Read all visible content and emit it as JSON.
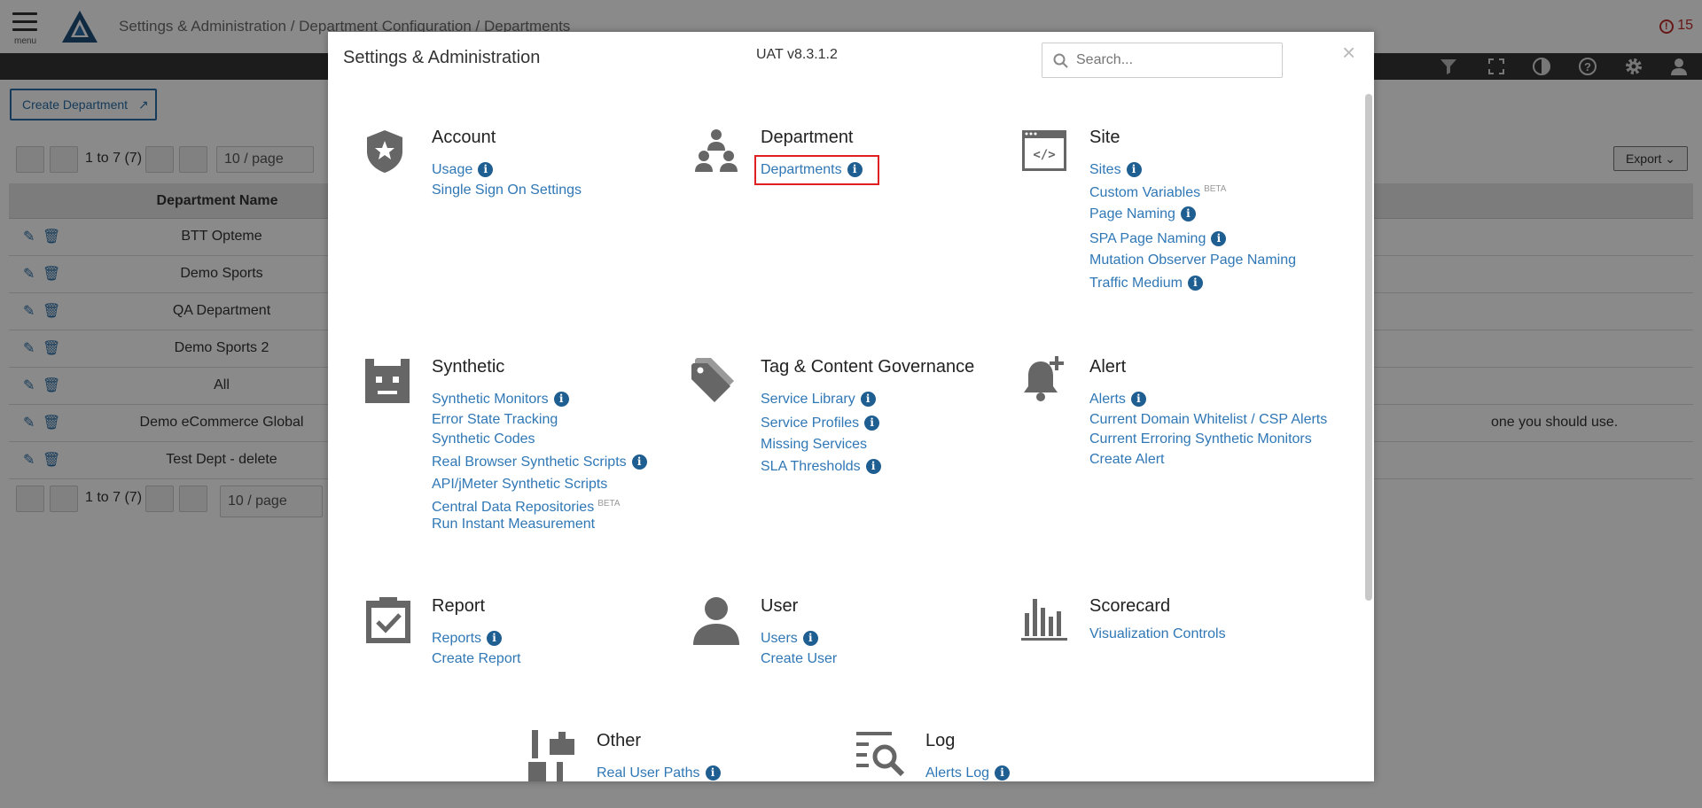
{
  "topbar": {
    "menu_label": "menu",
    "breadcrumb": "Settings & Administration / Department Configuration / Departments",
    "alert_count": "15"
  },
  "toolbar": {
    "create_department": "Create Department",
    "export": "Export"
  },
  "pager_top": {
    "range": "1 to 7 (7)",
    "page_size": "10 / page"
  },
  "pager_bottom": {
    "range": "1 to 7 (7)",
    "page_size": "10 / page"
  },
  "table": {
    "header": "Department Name",
    "rows": [
      "BTT Opteme",
      "Demo Sports",
      "QA Department",
      "Demo Sports 2",
      "All",
      "Demo eCommerce Global",
      "Test Dept - delete"
    ],
    "partial_text": "one you should use."
  },
  "modal": {
    "title": "Settings & Administration",
    "version": "UAT v8.3.1.2",
    "search_placeholder": "Search...",
    "close": "×",
    "sections": {
      "account": {
        "title": "Account",
        "links": [
          "Usage",
          "Single Sign On Settings"
        ]
      },
      "department": {
        "title": "Department",
        "links": [
          "Departments"
        ]
      },
      "site": {
        "title": "Site",
        "links": [
          "Sites",
          "Custom Variables",
          "Page Naming",
          "SPA Page Naming",
          "Mutation Observer Page Naming",
          "Traffic Medium"
        ],
        "beta": "BETA"
      },
      "synthetic": {
        "title": "Synthetic",
        "links": [
          "Synthetic Monitors",
          "Error State Tracking",
          "Synthetic Codes",
          "Real Browser Synthetic Scripts",
          "API/jMeter Synthetic Scripts",
          "Central Data Repositories",
          "Run Instant Measurement"
        ],
        "beta": "BETA"
      },
      "tag": {
        "title": "Tag & Content Governance",
        "links": [
          "Service Library",
          "Service Profiles",
          "Missing Services",
          "SLA Thresholds"
        ]
      },
      "alert": {
        "title": "Alert",
        "links": [
          "Alerts",
          "Current Domain Whitelist / CSP Alerts",
          "Current Erroring Synthetic Monitors",
          "Create Alert"
        ]
      },
      "report": {
        "title": "Report",
        "links": [
          "Reports",
          "Create Report"
        ]
      },
      "user": {
        "title": "User",
        "links": [
          "Users",
          "Create User"
        ]
      },
      "scorecard": {
        "title": "Scorecard",
        "links": [
          "Visualization Controls"
        ]
      },
      "other": {
        "title": "Other",
        "links": [
          "Real User Paths"
        ]
      },
      "log": {
        "title": "Log",
        "links": [
          "Alerts Log"
        ]
      }
    }
  },
  "colors": {
    "link": "#2f77b5",
    "info": "#1f5e91",
    "highlight": "#e02020",
    "dark_bar": "#343434"
  }
}
